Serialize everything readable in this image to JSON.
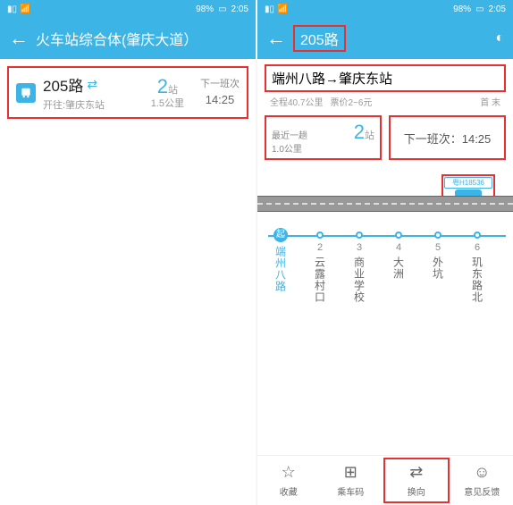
{
  "status": {
    "battery": "98%",
    "time": "2:05"
  },
  "left": {
    "title": "火车站综合体(肇庆大道）",
    "route_number": "205路",
    "destination_sub": "开往:肇庆东站",
    "stops_num": "2",
    "stops_unit": "站",
    "distance": "1.5公里",
    "next_label": "下一班次",
    "next_time": "14:25"
  },
  "right": {
    "title": "205路",
    "route_text": "端州八路→肇庆东站",
    "total_dist": "全程40.7公里",
    "fare": "票价2~6元",
    "schedule": "首 末",
    "recent_label": "最近一趟",
    "recent_dist": "1.0公里",
    "recent_stops_num": "2",
    "recent_stops_unit": "站",
    "next_label": "下一班次：",
    "next_time": "14:25",
    "plate": "粤H18536",
    "origin_badge": "起",
    "stops": [
      {
        "num": "",
        "name": "端州八路"
      },
      {
        "num": "2",
        "name": "云露村口"
      },
      {
        "num": "3",
        "name": "商业学校"
      },
      {
        "num": "4",
        "name": "大洲"
      },
      {
        "num": "5",
        "name": "外坑"
      },
      {
        "num": "6",
        "name": "玑东路北"
      }
    ],
    "nav": {
      "fav": "收藏",
      "qr": "乘车码",
      "swap": "换向",
      "feedback": "意见反馈"
    }
  }
}
